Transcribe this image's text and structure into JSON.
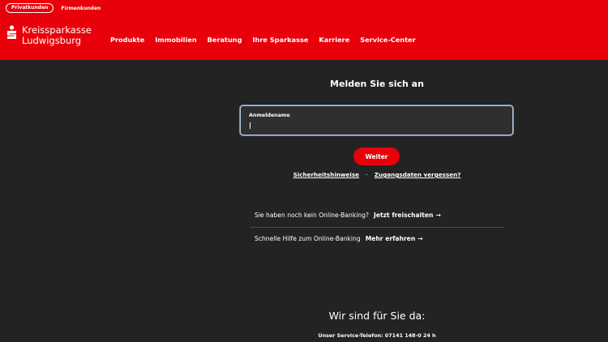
{
  "header": {
    "segment_private": "Privatkunden",
    "segment_business": "Firmenkunden",
    "brand_line1": "Kreissparkasse",
    "brand_line2": "Ludwigsburg",
    "brand_color": "#e8000a",
    "nav": [
      "Produkte",
      "Immobilien",
      "Beratung",
      "Ihre Sparkasse",
      "Karriere",
      "Service-Center"
    ]
  },
  "login": {
    "title": "Melden Sie sich an",
    "username_label": "Anmeldename",
    "username_value": "",
    "submit_label": "Weiter",
    "link_security": "Sicherheitshinweise",
    "link_separator": "·",
    "link_forgot": "Zugangsdaten vergessen?"
  },
  "info": [
    {
      "question": "Sie haben noch kein Online-Banking?",
      "action": "Jetzt freischalten",
      "icon": "arrow-right-icon"
    },
    {
      "question": "Schnelle Hilfe zum Online-Banking",
      "action": "Mehr erfahren",
      "icon": "arrow-right-icon"
    }
  ],
  "contact": {
    "title": "Wir sind für Sie da:",
    "phone_line": "Unser Service-Telefon: 07141 148-0 24 h"
  },
  "theme": {
    "background": "#232323",
    "field_border": "#b6cadf"
  }
}
